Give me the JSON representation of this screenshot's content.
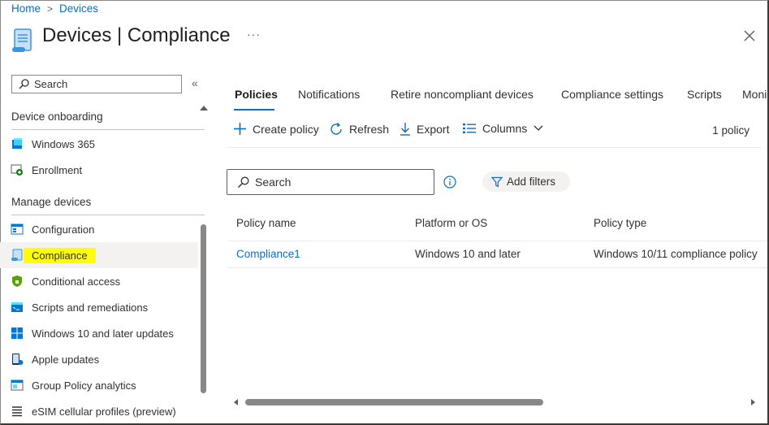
{
  "breadcrumb": {
    "home": "Home",
    "separator": ">",
    "current": "Devices"
  },
  "header": {
    "title": "Devices | Compliance",
    "more": "···"
  },
  "sidebar": {
    "search_placeholder": "Search",
    "collapse": "«",
    "sections": [
      {
        "heading": "Device onboarding",
        "items": [
          {
            "label": "Windows 365",
            "icon": "windows365-icon"
          },
          {
            "label": "Enrollment",
            "icon": "enrollment-icon"
          }
        ]
      },
      {
        "heading": "Manage devices",
        "items": [
          {
            "label": "Configuration",
            "icon": "configuration-icon"
          },
          {
            "label": "Compliance",
            "icon": "compliance-icon",
            "active": true
          },
          {
            "label": "Conditional access",
            "icon": "shield-icon"
          },
          {
            "label": "Scripts and remediations",
            "icon": "scripts-icon"
          },
          {
            "label": "Windows 10 and later updates",
            "icon": "windows-logo-icon"
          },
          {
            "label": "Apple updates",
            "icon": "apple-device-icon"
          },
          {
            "label": "Group Policy analytics",
            "icon": "group-policy-icon"
          },
          {
            "label": "eSIM cellular profiles (preview)",
            "icon": "list-icon"
          }
        ]
      }
    ]
  },
  "tabs": [
    "Policies",
    "Notifications",
    "Retire noncompliant devices",
    "Compliance settings",
    "Scripts",
    "Moni"
  ],
  "toolbar": {
    "create": "Create policy",
    "refresh": "Refresh",
    "export": "Export",
    "columns": "Columns",
    "count": "1 policy"
  },
  "filter": {
    "search_placeholder": "Search",
    "add_filters": "Add filters"
  },
  "table": {
    "columns": [
      "Policy name",
      "Platform or OS",
      "Policy type"
    ],
    "rows": [
      [
        "Compliance1",
        "Windows 10 and later",
        "Windows 10/11 compliance policy"
      ]
    ]
  },
  "colors": {
    "accent": "#0f6cbd",
    "highlight": "#ffff00",
    "selected_bg": "#f3f2f1"
  }
}
